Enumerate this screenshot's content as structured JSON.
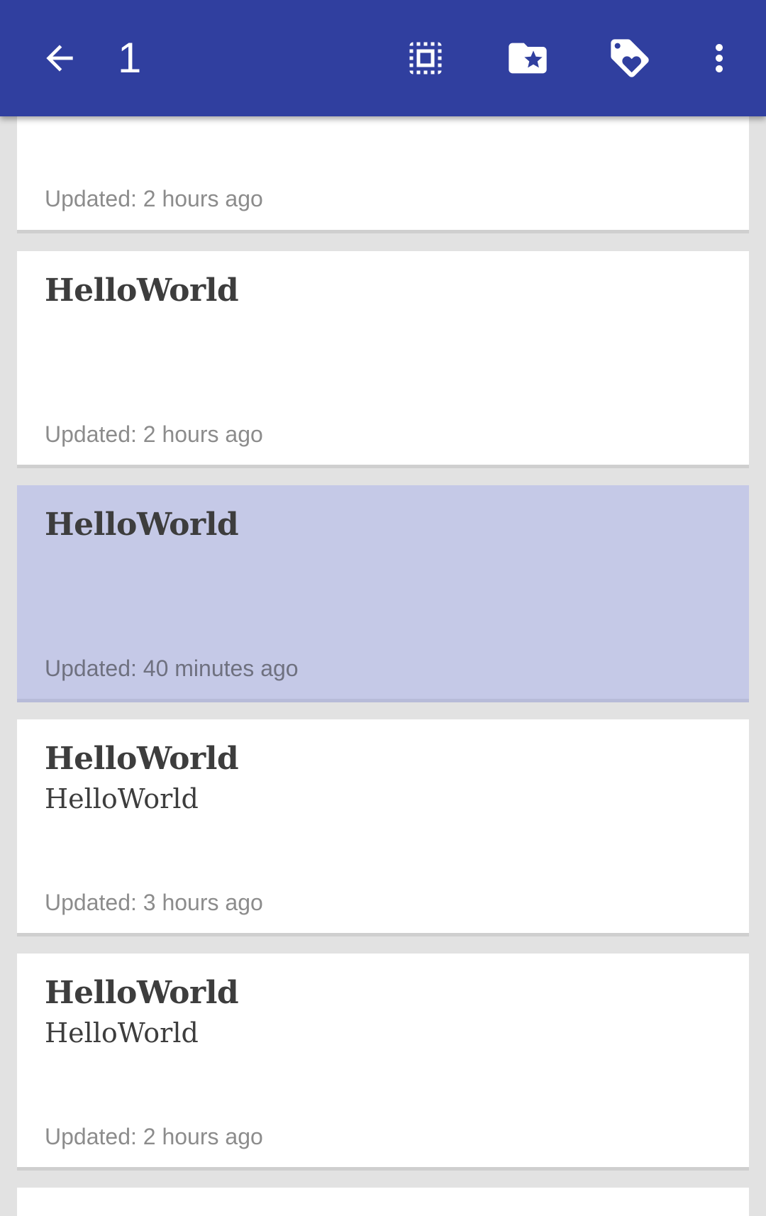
{
  "app_bar": {
    "back_icon": "arrow-back-icon",
    "selection_count": "1",
    "actions": [
      {
        "name": "select-all",
        "icon": "select-all-icon"
      },
      {
        "name": "move-to-folder",
        "icon": "folder-star-icon"
      },
      {
        "name": "tag",
        "icon": "tag-heart-icon"
      },
      {
        "name": "more-options",
        "icon": "more-vert-icon"
      }
    ],
    "background_color": "#303f9f"
  },
  "notes": [
    {
      "title": "",
      "body": "",
      "updated": "Updated: 2 hours ago",
      "selected": false
    },
    {
      "title": "HelloWorld",
      "body": "",
      "updated": "Updated: 2 hours ago",
      "selected": false
    },
    {
      "title": "HelloWorld",
      "body": "",
      "updated": "Updated: 40 minutes ago",
      "selected": true
    },
    {
      "title": "HelloWorld",
      "body": "HelloWorld",
      "updated": "Updated: 3 hours ago",
      "selected": false
    },
    {
      "title": "HelloWorld",
      "body": "HelloWorld",
      "updated": "Updated: 2 hours ago",
      "selected": false
    }
  ],
  "colors": {
    "selected_card": "#c5c9e7",
    "card": "#ffffff",
    "background": "#e2e2e2"
  }
}
